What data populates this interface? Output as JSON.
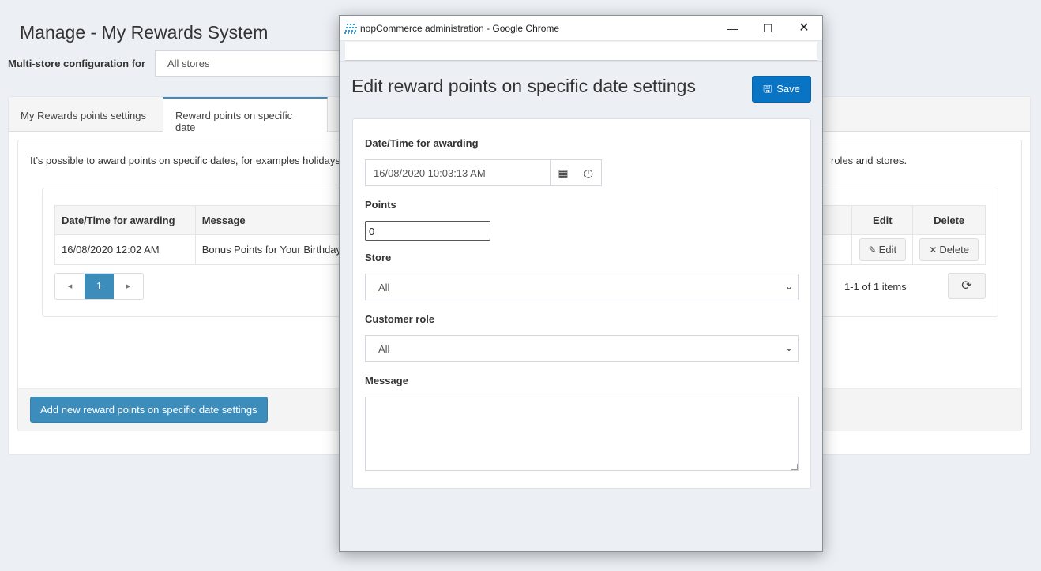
{
  "page": {
    "title": "Manage - My Rewards System",
    "multistore_label": "Multi-store configuration for",
    "multistore_value": "All stores"
  },
  "tabs": [
    {
      "label": "My Rewards points settings"
    },
    {
      "label": "Reward points on specific date"
    }
  ],
  "description": {
    "left": "It’s possible to award points on specific dates, for examples holidays",
    "right": "roles and stores."
  },
  "grid": {
    "columns": [
      "Date/Time for awarding",
      "Message",
      "Edit",
      "Delete"
    ],
    "rows": [
      {
        "datetime": "16/08/2020 12:02 AM",
        "message": "Bonus Points for Your Birthday",
        "edit": "Edit",
        "delete": "Delete"
      }
    ],
    "pager": {
      "prev": "◂",
      "page": "1",
      "next": "▸",
      "info": "1-1 of 1 items"
    }
  },
  "add_button": "Add new reward points on specific date settings",
  "popup": {
    "window_title": "nopCommerce administration - Google Chrome",
    "heading": "Edit reward points on specific date settings",
    "save_label": "Save",
    "fields": {
      "datetime_label": "Date/Time for awarding",
      "datetime_value": "16/08/2020 10:03:13 AM",
      "points_label": "Points",
      "points_value": "0",
      "store_label": "Store",
      "store_value": "All",
      "role_label": "Customer role",
      "role_value": "All",
      "message_label": "Message",
      "message_value": ""
    }
  },
  "icons": {
    "edit": "pencil-icon",
    "delete": "times-icon",
    "refresh": "refresh-icon",
    "calendar": "calendar-icon",
    "clock": "clock-icon",
    "save": "floppy-disk-icon",
    "chevron": "chevron-down-icon"
  },
  "colors": {
    "primary": "#3c8dbc",
    "save": "#0a74c4",
    "background": "#ecf0f5"
  }
}
